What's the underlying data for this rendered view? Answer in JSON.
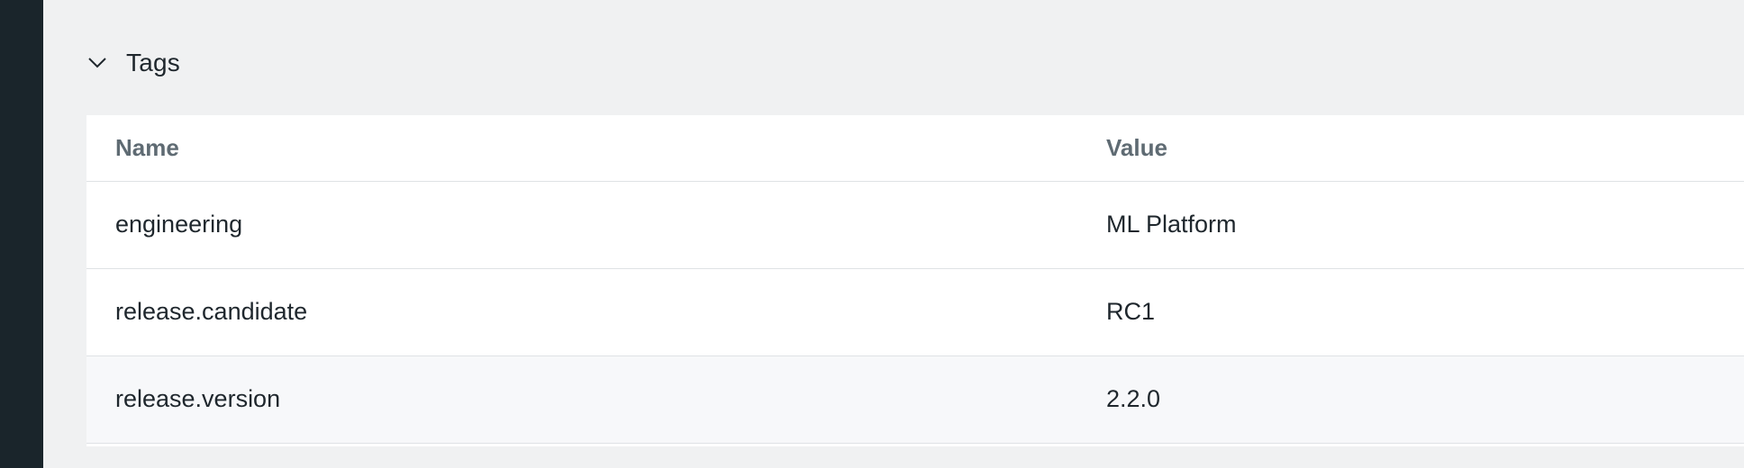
{
  "section": {
    "title": "Tags",
    "expanded": true,
    "toggle_icon": "chevron-down-icon"
  },
  "table": {
    "columns": [
      "Name",
      "Value"
    ],
    "rows": [
      {
        "name": "engineering",
        "value": "ML Platform"
      },
      {
        "name": "release.candidate",
        "value": "RC1"
      },
      {
        "name": "release.version",
        "value": "2.2.0"
      }
    ]
  },
  "colors": {
    "page_background": "#f0f1f2",
    "left_rail": "#1a252b",
    "table_background": "#ffffff",
    "header_text": "#5f6b73",
    "body_text": "#1f272d"
  }
}
